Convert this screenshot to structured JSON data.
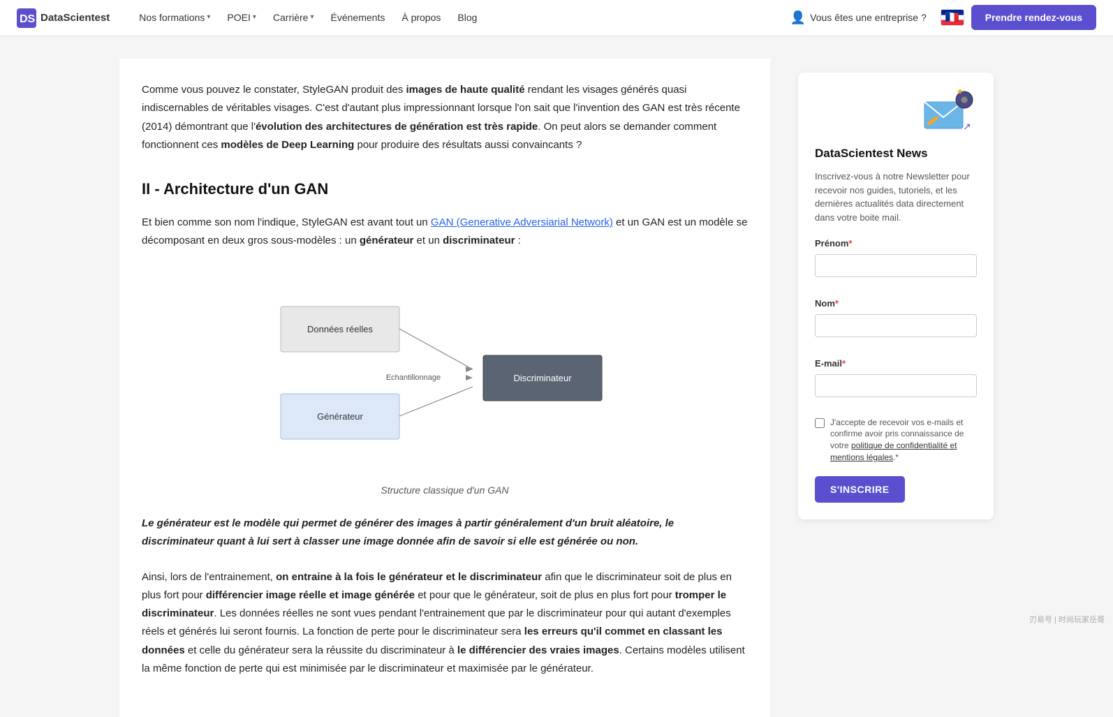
{
  "nav": {
    "logo_text": "DataScientest",
    "items": [
      {
        "label": "Nos formations",
        "has_chevron": true
      },
      {
        "label": "POEI",
        "has_chevron": true
      },
      {
        "label": "Carrière",
        "has_chevron": true
      },
      {
        "label": "Événements",
        "has_chevron": false
      },
      {
        "label": "À propos",
        "has_chevron": false
      },
      {
        "label": "Blog",
        "has_chevron": false
      }
    ],
    "enterprise_label": "Vous êtes une entreprise ?",
    "cta_label": "Prendre rendez-vous"
  },
  "main": {
    "intro": {
      "p1_before": "Comme vous pouvez le constater, StyleGAN produit des ",
      "p1_bold1": "images de haute qualité",
      "p1_after": " rendant les visages générés quasi indiscernables de véritables visages. C'est d'autant plus impressionnant lorsque l'on sait que l'invention des GAN est très récente (2014) démontrant que l'",
      "p1_bold2": "évolution des architectures de génération est très rapide",
      "p1_end": ". On peut alors se demander comment fonctionnent ces ",
      "p1_bold3": "modèles de Deep Learning",
      "p1_final": " pour produire des résultats aussi convaincants ?"
    },
    "section_heading": "II - Architecture d'un GAN",
    "body1_before": "Et bien comme son nom l'indique, StyleGAN est avant tout un ",
    "body1_link": "GAN (Generative Adversiarial Network)",
    "body1_after": " et un GAN est un modèle se décomposant en deux gros sous-modèles : un ",
    "body1_bold1": "générateur",
    "body1_mid": " et un ",
    "body1_bold2": "discriminateur",
    "body1_end": " :",
    "diagram_caption": "Structure classique d'un GAN",
    "diagram_nodes": {
      "donnees": "Données réelles",
      "generateur": "Générateur",
      "echantillonnage": "Echantillonnage",
      "discriminateur": "Discriminateur"
    },
    "quote": "Le générateur est le modèle qui permet de générer des images à partir généralement d'un bruit aléatoire, le discriminateur quant à lui sert à classer une image donnée afin de savoir si elle est générée ou non.",
    "body2_before": "Ainsi, lors de l'entrainement, ",
    "body2_bold1": "on entraine à la fois le générateur et le discriminateur",
    "body2_after": " afin que le discriminateur soit de plus en plus fort pour ",
    "body2_bold2": "différencier image réelle et image générée",
    "body2_mid": " et pour que le générateur, soit de plus en plus fort pour ",
    "body2_bold3": "tromper le discriminateur",
    "body2_cont": ". Les données réelles ne sont vues pendant l'entrainement que par le discriminateur pour qui autant d'exemples réels et générés lui seront fournis. La fonction de perte pour le discriminateur sera ",
    "body2_bold4": "les erreurs qu'il commet en classant les données",
    "body2_cont2": " et celle du générateur sera la réussite du discriminateur à ",
    "body2_bold5": "le différencier des vraies images",
    "body2_end": ". Certains modèles utilisent la même fonction de perte qui est minimisée par le discriminateur et maximisée par le générateur."
  },
  "sidebar": {
    "title": "DataScientest News",
    "description": "Inscrivez-vous à notre Newsletter pour recevoir nos guides, tutoriels, et les dernières actualités data directement dans votre boite mail.",
    "form": {
      "prenom_label": "Prénom",
      "prenom_required": true,
      "nom_label": "Nom",
      "nom_required": true,
      "email_label": "E-mail",
      "email_required": true,
      "checkbox_text": "J'accepte de recevoir vos e-mails et confirme avoir pris connaissance de votre politique de confidentialité et mentions légales.",
      "submit_label": "S'INSCRIRE"
    }
  },
  "watermark": "刃易号 | 时尚玩家岳哥"
}
